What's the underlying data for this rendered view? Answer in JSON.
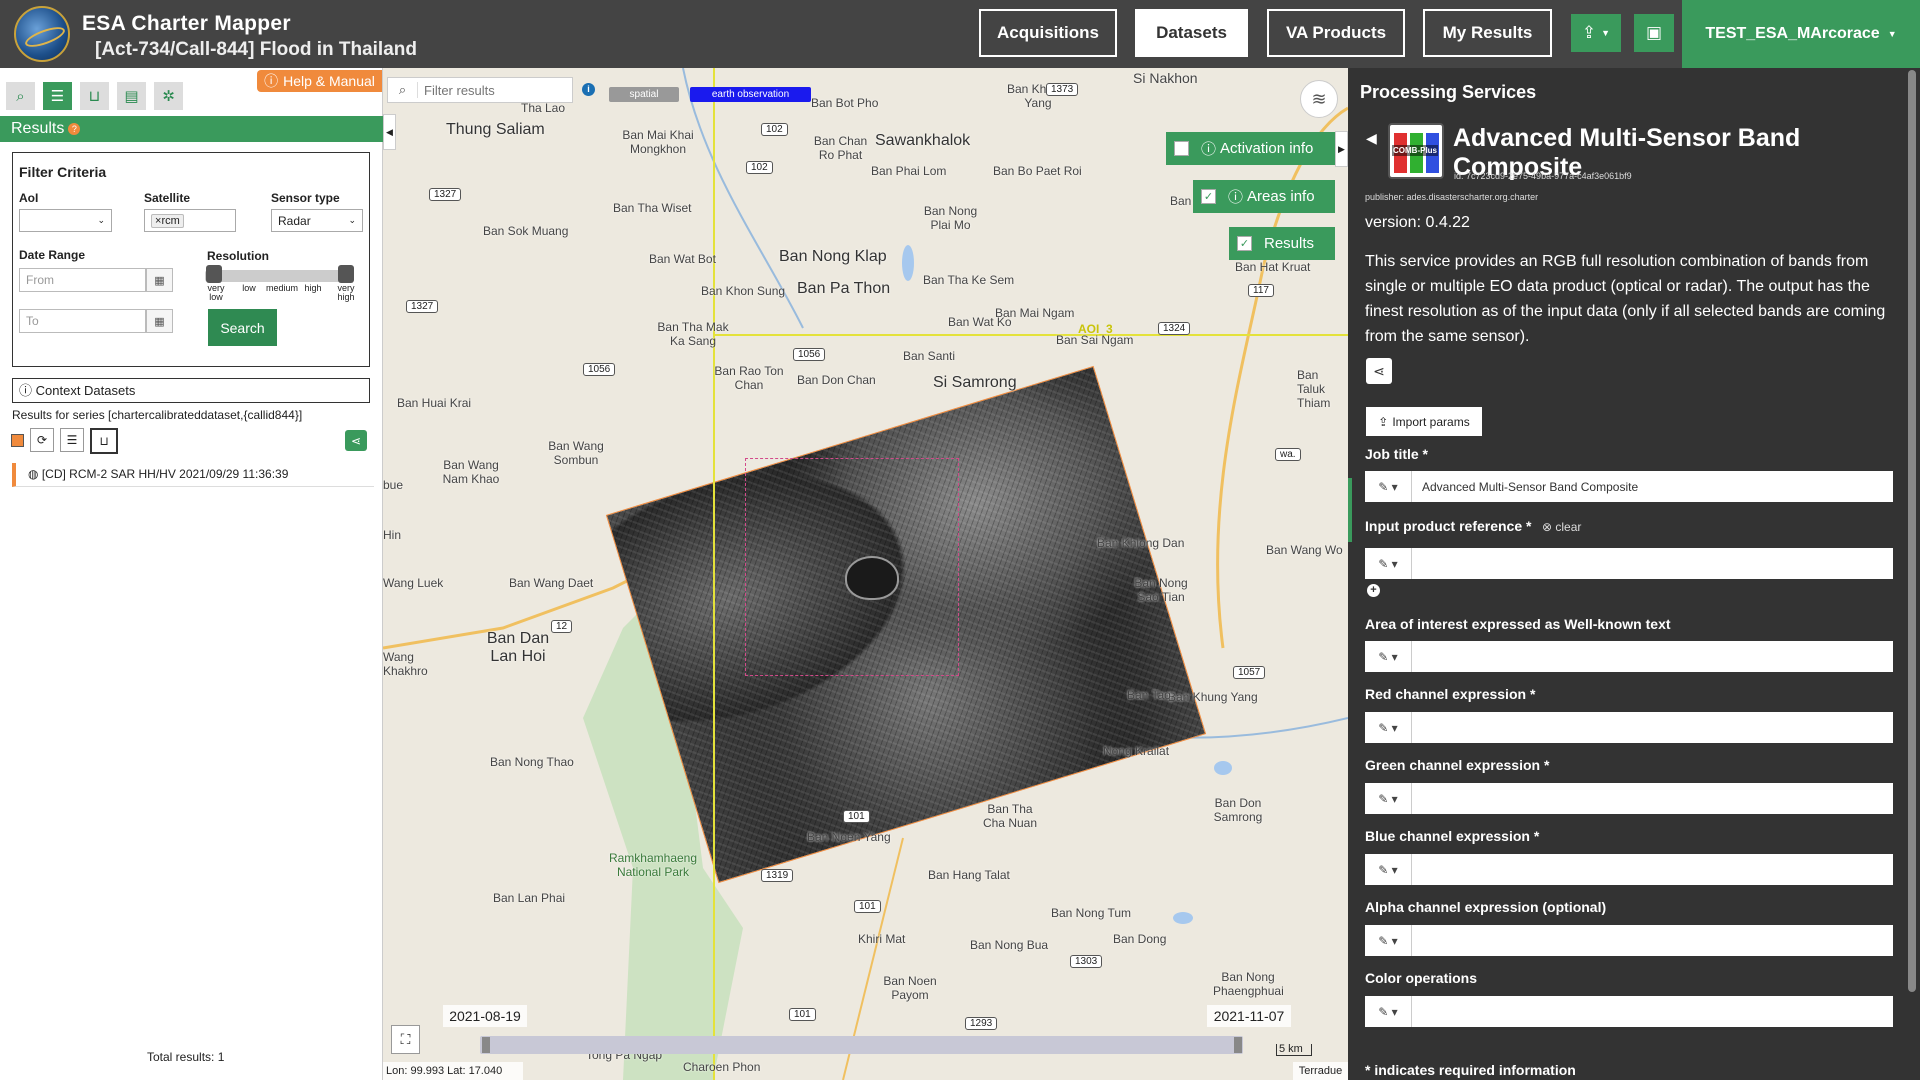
{
  "header": {
    "app_title": "ESA Charter Mapper",
    "subtitle": "[Act-734/Call-844] Flood in Thailand",
    "nav": [
      "Acquisitions",
      "Datasets",
      "VA Products",
      "My Results"
    ],
    "active_nav": "Datasets",
    "user": "TEST_ESA_MArcorace",
    "colors": {
      "bar": "#444444",
      "accent": "#3a9a5c"
    }
  },
  "left": {
    "help_label": "Help & Manual",
    "results_title": "Results",
    "filter": {
      "title": "Filter Criteria",
      "aoi_label": "AoI",
      "aoi_value": "",
      "satellite_label": "Satellite",
      "satellite_tag": "rcm",
      "sensor_label": "Sensor type",
      "sensor_value": "Radar",
      "date_label": "Date Range",
      "from_placeholder": "From",
      "to_placeholder": "To",
      "resolution_label": "Resolution",
      "resolution_levels": [
        "very low",
        "low",
        "medium",
        "high",
        "very high"
      ],
      "search_label": "Search"
    },
    "context_title": "Context Datasets",
    "series_text": "Results for series [chartercalibrateddataset,{callid844}]",
    "result_item": "[CD] RCM-2 SAR HH/HV 2021/09/29 11:36:39",
    "total": "Total results: 1"
  },
  "map": {
    "filter_placeholder": "Filter results",
    "tag_spatial": "spatial",
    "tag_eo": "earth observation",
    "overlays": {
      "activation": "Activation info",
      "areas": "Areas info",
      "results": "Results"
    },
    "aoi_label": "AOI_3",
    "date_start": "2021-08-19",
    "date_end": "2021-11-07",
    "scale": "5 km",
    "coords": "Lon: 99.993 Lat: 17.040",
    "attribution": "Terradue",
    "places": [
      "Si Nakhon",
      "Ban Khlong Yang",
      "Thung Saliam",
      "Ban Mai Khai Mongkhon",
      "Ban Chan Ro Phat",
      "Sawankhalok",
      "Ban Phai Lom",
      "Ban Bo Paet Roi",
      "Ban Sok Muang",
      "Ban Tha Wiset",
      "Ban Nong Plai Mo",
      "Ban Pha Ta",
      "Ban Wat Bot",
      "Ban Nong Klap",
      "Ban Khon Sung",
      "Ban Pa Thon",
      "Ban Tha Ke Sem",
      "Ban Hat Kruat",
      "Ban Mai Ngam",
      "Ban Tha Mak Ka Sang",
      "Ban Wat Ko",
      "Ban Sai Ngam",
      "Ban Rao Ton Chan",
      "Ban Santi",
      "Ban Don Chan",
      "Si Samrong",
      "Ban Taluk Thiam",
      "Ban Huai Krai",
      "Ban Wang Sombun",
      "Ban Wang Nam Khao",
      "Ban Khlong Dan",
      "Ban Wang Wo",
      "Ban Wang Daet",
      "Ban Nong Sao Tian",
      "Ban Dan Lan Hoi",
      "Ban Khung Yang",
      "Ban Nong Thao",
      "Nong Krailat",
      "Ban Don Samrong",
      "Ban Tha Cha Nuan",
      "Ban Noen Yang",
      "Ramkhamhaeng National Park",
      "Ban Hang Talat",
      "Ban Lan Phai",
      "Ban Nong Tum",
      "Khiri Mat",
      "Ban Nong Bua",
      "Ban Dong",
      "Ban Noen Payom",
      "Ban Nong Phaengphuai",
      "Charoen Phon",
      "Tong Pa Ngap",
      "Wang Luek",
      "Ban Tao",
      "Wang Khakhro",
      "Hin",
      "bue",
      "Ban Bot Pho",
      "Tha Lao"
    ],
    "roads": [
      "1373",
      "102",
      "102",
      "1327",
      "1327",
      "117",
      "1324",
      "1056",
      "1056",
      "12",
      "1057",
      "101",
      "1319",
      "101",
      "1303",
      "101",
      "1293",
      "wa."
    ]
  },
  "right": {
    "header": "Processing Services",
    "service_title": "Advanced Multi-Sensor Band Composite",
    "icon_text": "COMB-Plus",
    "service_id": "id: 7c723cd9-2e75-49ba-977a-c4af3e061bf9",
    "publisher": "publisher: ades.disasterscharter.org.charter",
    "version": "version: 0.4.22",
    "description": "This service provides an RGB full resolution combination of bands from single or multiple EO data product (optical or radar). The output has the finest resolution as of the input data (only if all selected bands are coming from the same sensor).",
    "import_label": "Import params",
    "clear_label": "clear",
    "fields": [
      {
        "label": "Job title *",
        "value": "Advanced Multi-Sensor Band Composite"
      },
      {
        "label": "Input product reference *",
        "value": ""
      },
      {
        "label": "Area of interest expressed as Well-known text",
        "value": ""
      },
      {
        "label": "Red channel expression *",
        "value": ""
      },
      {
        "label": "Green channel expression *",
        "value": ""
      },
      {
        "label": "Blue channel expression *",
        "value": ""
      },
      {
        "label": "Alpha channel expression (optional)",
        "value": ""
      },
      {
        "label": "Color operations",
        "value": ""
      }
    ],
    "required_note": "* indicates required information"
  }
}
